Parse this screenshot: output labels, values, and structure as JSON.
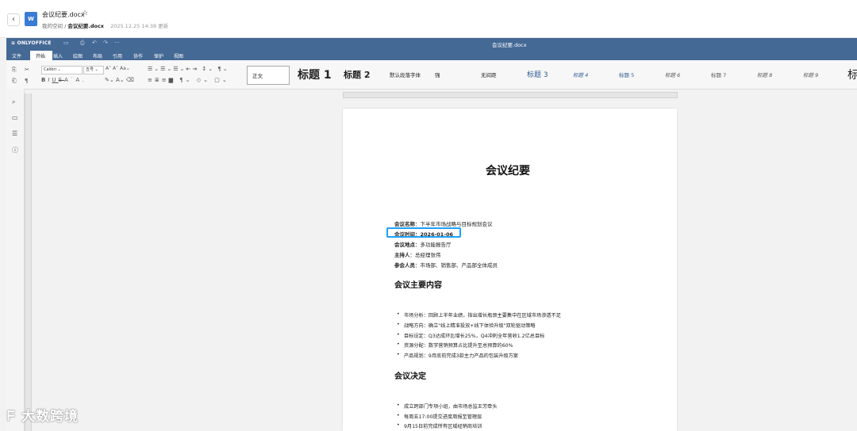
{
  "header": {
    "doc_title": "会议纪要.docx",
    "breadcrumb_root": "我的空间",
    "breadcrumb_sep": "/",
    "breadcrumb_file": "会议纪要.docx",
    "timestamp": "2025.12.25 14:38 更新"
  },
  "editor": {
    "logo": "ONLYOFFICE",
    "window_title": "会议纪要.docx",
    "menu": [
      "文件",
      "开始",
      "插入",
      "绘图",
      "布局",
      "引用",
      "协作",
      "保护",
      "视图"
    ],
    "font_name": "Calibri",
    "font_size": "五号",
    "styles": [
      "正文",
      "标题 1",
      "标题 2",
      "默认段落字体",
      "强",
      "无间距",
      "标题 3",
      "标题 4",
      "标题 5",
      "标题 6",
      "标题 7",
      "标题 8",
      "标题 9",
      "标"
    ]
  },
  "document": {
    "title": "会议纪要",
    "meta": [
      {
        "label": "会议名称",
        "value": "：下半年市场战略与目标规划会议"
      },
      {
        "label": "会议时间",
        "value": "：2026-01-06"
      },
      {
        "label": "会议地点",
        "value": "：多功能报告厅"
      },
      {
        "label": "主持人",
        "value": "：总经理张伟"
      },
      {
        "label": "参会人员",
        "value": "：市场部、销售部、产品部全体成员"
      }
    ],
    "section1_title": "会议主要内容",
    "section1_items": [
      "市场分析：回顾上半年业绩，指出增长瓶颈主要集中在区域市场渗透不足",
      "战略方向：确立\"线上精准投放+线下体验升级\"双轮驱动策略",
      "目标设定：Q3达成环比增长25%，Q4冲刺全年营收1.2亿总目标",
      "资源分配：数字营销预算占比提升至总预算的60%",
      "产品规划：9月底前完成3款主力产品的包装升级方案"
    ],
    "section2_title": "会议决定",
    "section2_items": [
      "成立跨部门专项小组，由市场总监王芳牵头",
      "每周五17:00提交进度周报至管理层",
      "9月15日前完成所有区域经销商培训"
    ]
  },
  "watermark": "大数跨境"
}
